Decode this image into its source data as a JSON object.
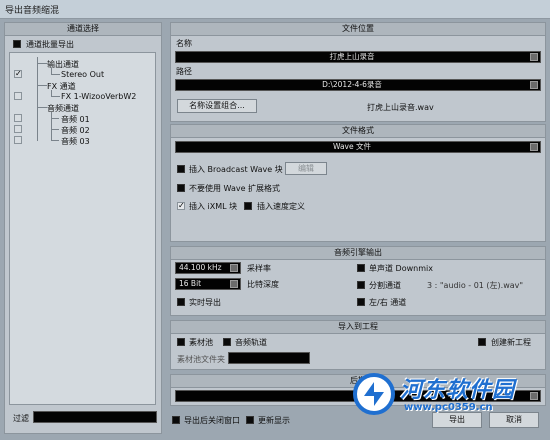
{
  "window": {
    "title": "导出音频缩混"
  },
  "channel_panel": {
    "header": "通道选择",
    "batch_export_label": "通道批量导出",
    "tree": {
      "output_group": "输出通道",
      "stereo_out": "Stereo Out",
      "fx_group": "FX 通道",
      "fx_item": "FX 1-WizooVerbW2",
      "audio_group": "音频通道",
      "audio_items": [
        "音频 01",
        "音频 02",
        "音频 03"
      ]
    },
    "filter_label": "过滤"
  },
  "file_location": {
    "header": "文件位置",
    "name_label": "名称",
    "name_value": "打虎上山录音",
    "path_label": "路径",
    "path_value": "D:\\2012-4-6录音",
    "name_settings_button": "名称设置组合...",
    "preview_filename": "打虎上山录音.wav"
  },
  "file_format": {
    "header": "文件格式",
    "format_value": "Wave 文件",
    "insert_broadcast": "插入 Broadcast Wave 块",
    "edit_button": "编辑",
    "no_wave_ext": "不要使用 Wave 扩展格式",
    "insert_ixml": "插入 iXML 块",
    "insert_tempo": "插入速度定义"
  },
  "engine_output": {
    "header": "音频引擎输出",
    "sample_rate_value": "44.100 kHz",
    "sample_rate_label": "采样率",
    "bit_depth_value": "16 Bit",
    "bit_depth_label": "比特深度",
    "realtime_export": "实时导出",
    "mono_downmix": "单声道 Downmix",
    "split_channels": "分割通道",
    "split_hint": "3 : \"audio - 01 (左).wav\"",
    "lr_channels": "左/右 通道"
  },
  "import_project": {
    "header": "导入到工程",
    "pool": "素材池",
    "audio_track": "音频轨道",
    "create_project": "创建新工程",
    "pool_folder_label": "素材池文件夹"
  },
  "post_process": {
    "header": "后期"
  },
  "footer": {
    "close_after_export": "导出后关闭窗口",
    "update_display": "更新显示",
    "export_button": "导出",
    "cancel_button": "取消"
  },
  "watermark": {
    "site_name": "河东软件园",
    "url": "www.pc0359.cn"
  },
  "colors": {
    "panel": "#c0c7ce",
    "field": "#030303",
    "accent_blue": "#1f6fd0"
  }
}
